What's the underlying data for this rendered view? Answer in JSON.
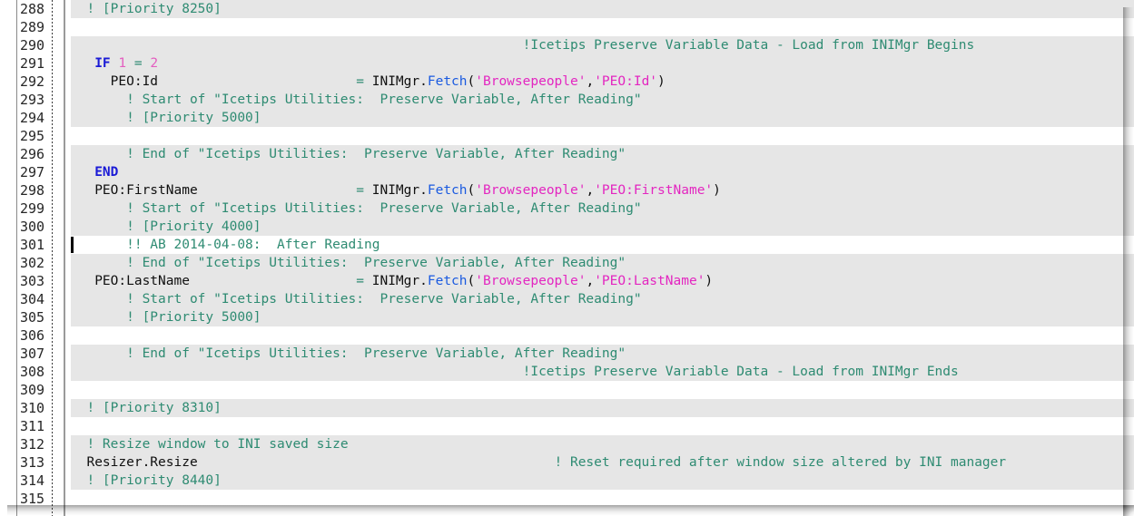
{
  "editor": {
    "language": "Clarion",
    "first_line": 288,
    "last_line": 315,
    "current_line": 301,
    "line_height_px": 20,
    "colors": {
      "comment": "#2e8b72",
      "keyword": "#1a1ad6",
      "number": "#e45ec0",
      "string": "#e326c0",
      "function": "#1a5ae0",
      "plain": "#101010",
      "band_background": "#e6e6e6",
      "background": "#ffffff",
      "gutter_text": "#262626",
      "caret": "#000000"
    }
  },
  "gutter": {
    "numbers": [
      "288",
      "289",
      "290",
      "291",
      "292",
      "293",
      "294",
      "295",
      "296",
      "297",
      "298",
      "299",
      "300",
      "301",
      "302",
      "303",
      "304",
      "305",
      "306",
      "307",
      "308",
      "309",
      "310",
      "311",
      "312",
      "313",
      "314",
      "315"
    ]
  },
  "lines": [
    {
      "n": "288",
      "band": true,
      "cur": false,
      "tokens": [
        {
          "t": "plain",
          "v": "  "
        },
        {
          "t": "comment",
          "v": "! [Priority 8250]"
        }
      ]
    },
    {
      "n": "289",
      "band": false,
      "cur": false,
      "tokens": []
    },
    {
      "n": "290",
      "band": true,
      "cur": false,
      "tokens": [
        {
          "t": "plain",
          "v": "                                                         "
        },
        {
          "t": "comment",
          "v": "!Icetips Preserve Variable Data - Load from INIMgr Begins"
        }
      ]
    },
    {
      "n": "291",
      "band": true,
      "cur": false,
      "tokens": [
        {
          "t": "plain",
          "v": "   "
        },
        {
          "t": "keyword",
          "v": "IF"
        },
        {
          "t": "plain",
          "v": " "
        },
        {
          "t": "number",
          "v": "1"
        },
        {
          "t": "plain",
          "v": " "
        },
        {
          "t": "op",
          "v": "="
        },
        {
          "t": "plain",
          "v": " "
        },
        {
          "t": "number",
          "v": "2"
        }
      ]
    },
    {
      "n": "292",
      "band": true,
      "cur": false,
      "tokens": [
        {
          "t": "plain",
          "v": "     PEO:Id                         "
        },
        {
          "t": "op",
          "v": "="
        },
        {
          "t": "plain",
          "v": " INIMgr"
        },
        {
          "t": "plain",
          "v": "."
        },
        {
          "t": "function",
          "v": "Fetch"
        },
        {
          "t": "plain",
          "v": "("
        },
        {
          "t": "string",
          "v": "'Browsepeople'"
        },
        {
          "t": "plain",
          "v": ","
        },
        {
          "t": "string",
          "v": "'PEO:Id'"
        },
        {
          "t": "plain",
          "v": ")"
        }
      ]
    },
    {
      "n": "293",
      "band": true,
      "cur": false,
      "tokens": [
        {
          "t": "plain",
          "v": "       "
        },
        {
          "t": "comment",
          "v": "! Start of \"Icetips Utilities:  Preserve Variable, After Reading\""
        }
      ]
    },
    {
      "n": "294",
      "band": true,
      "cur": false,
      "tokens": [
        {
          "t": "plain",
          "v": "       "
        },
        {
          "t": "comment",
          "v": "! [Priority 5000]"
        }
      ]
    },
    {
      "n": "295",
      "band": false,
      "cur": false,
      "tokens": []
    },
    {
      "n": "296",
      "band": true,
      "cur": false,
      "tokens": [
        {
          "t": "plain",
          "v": "       "
        },
        {
          "t": "comment",
          "v": "! End of \"Icetips Utilities:  Preserve Variable, After Reading\""
        }
      ]
    },
    {
      "n": "297",
      "band": true,
      "cur": false,
      "tokens": [
        {
          "t": "plain",
          "v": "   "
        },
        {
          "t": "keyword",
          "v": "END"
        }
      ]
    },
    {
      "n": "298",
      "band": true,
      "cur": false,
      "tokens": [
        {
          "t": "plain",
          "v": "   PEO:FirstName                    "
        },
        {
          "t": "op",
          "v": "="
        },
        {
          "t": "plain",
          "v": " INIMgr"
        },
        {
          "t": "plain",
          "v": "."
        },
        {
          "t": "function",
          "v": "Fetch"
        },
        {
          "t": "plain",
          "v": "("
        },
        {
          "t": "string",
          "v": "'Browsepeople'"
        },
        {
          "t": "plain",
          "v": ","
        },
        {
          "t": "string",
          "v": "'PEO:FirstName'"
        },
        {
          "t": "plain",
          "v": ")"
        }
      ]
    },
    {
      "n": "299",
      "band": true,
      "cur": false,
      "tokens": [
        {
          "t": "plain",
          "v": "       "
        },
        {
          "t": "comment",
          "v": "! Start of \"Icetips Utilities:  Preserve Variable, After Reading\""
        }
      ]
    },
    {
      "n": "300",
      "band": true,
      "cur": false,
      "tokens": [
        {
          "t": "plain",
          "v": "       "
        },
        {
          "t": "comment",
          "v": "! [Priority 4000]"
        }
      ]
    },
    {
      "n": "301",
      "band": false,
      "cur": true,
      "tokens": [
        {
          "t": "plain",
          "v": "       "
        },
        {
          "t": "comment",
          "v": "!! AB 2014-04-08:  After Reading"
        }
      ]
    },
    {
      "n": "302",
      "band": true,
      "cur": false,
      "tokens": [
        {
          "t": "plain",
          "v": "       "
        },
        {
          "t": "comment",
          "v": "! End of \"Icetips Utilities:  Preserve Variable, After Reading\""
        }
      ]
    },
    {
      "n": "303",
      "band": true,
      "cur": false,
      "tokens": [
        {
          "t": "plain",
          "v": "   PEO:LastName                     "
        },
        {
          "t": "op",
          "v": "="
        },
        {
          "t": "plain",
          "v": " INIMgr"
        },
        {
          "t": "plain",
          "v": "."
        },
        {
          "t": "function",
          "v": "Fetch"
        },
        {
          "t": "plain",
          "v": "("
        },
        {
          "t": "string",
          "v": "'Browsepeople'"
        },
        {
          "t": "plain",
          "v": ","
        },
        {
          "t": "string",
          "v": "'PEO:LastName'"
        },
        {
          "t": "plain",
          "v": ")"
        }
      ]
    },
    {
      "n": "304",
      "band": true,
      "cur": false,
      "tokens": [
        {
          "t": "plain",
          "v": "       "
        },
        {
          "t": "comment",
          "v": "! Start of \"Icetips Utilities:  Preserve Variable, After Reading\""
        }
      ]
    },
    {
      "n": "305",
      "band": true,
      "cur": false,
      "tokens": [
        {
          "t": "plain",
          "v": "       "
        },
        {
          "t": "comment",
          "v": "! [Priority 5000]"
        }
      ]
    },
    {
      "n": "306",
      "band": false,
      "cur": false,
      "tokens": []
    },
    {
      "n": "307",
      "band": true,
      "cur": false,
      "tokens": [
        {
          "t": "plain",
          "v": "       "
        },
        {
          "t": "comment",
          "v": "! End of \"Icetips Utilities:  Preserve Variable, After Reading\""
        }
      ]
    },
    {
      "n": "308",
      "band": true,
      "cur": false,
      "tokens": [
        {
          "t": "plain",
          "v": "                                                         "
        },
        {
          "t": "comment",
          "v": "!Icetips Preserve Variable Data - Load from INIMgr Ends"
        }
      ]
    },
    {
      "n": "309",
      "band": false,
      "cur": false,
      "tokens": []
    },
    {
      "n": "310",
      "band": true,
      "cur": false,
      "tokens": [
        {
          "t": "plain",
          "v": "  "
        },
        {
          "t": "comment",
          "v": "! [Priority 8310]"
        }
      ]
    },
    {
      "n": "311",
      "band": false,
      "cur": false,
      "tokens": []
    },
    {
      "n": "312",
      "band": true,
      "cur": false,
      "tokens": [
        {
          "t": "plain",
          "v": "  "
        },
        {
          "t": "comment",
          "v": "! Resize window to INI saved size"
        }
      ]
    },
    {
      "n": "313",
      "band": true,
      "cur": false,
      "tokens": [
        {
          "t": "plain",
          "v": "  Resizer.Resize                                             "
        },
        {
          "t": "comment",
          "v": "! Reset required after window size altered by INI manager"
        }
      ]
    },
    {
      "n": "314",
      "band": true,
      "cur": false,
      "tokens": [
        {
          "t": "plain",
          "v": "  "
        },
        {
          "t": "comment",
          "v": "! [Priority 8440]"
        }
      ]
    },
    {
      "n": "315",
      "band": false,
      "cur": false,
      "tokens": []
    }
  ]
}
